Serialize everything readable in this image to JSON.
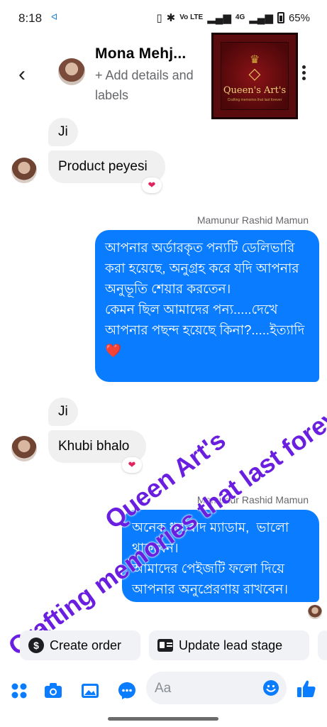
{
  "status": {
    "time": "8:18",
    "carrier": "ᐊ",
    "network": "Vo LTE",
    "net2": "4G",
    "battery": "65%"
  },
  "header": {
    "back_icon": "chevron-left-icon",
    "name": "Mona Mehj...",
    "subtitle": "+ Add details and labels",
    "logo": {
      "brand": "Queen's Art's",
      "tagline": "Crafting memories that last forever"
    },
    "more_icon": "more-vertical-icon"
  },
  "messages": {
    "in1_a": "Ji",
    "in1_b": "Product peyesi",
    "in1_react": "❤",
    "sender1": "Mamunur Rashid Mamun",
    "out1": "আপনার অর্ডারকৃত পন্যটি ডেলিভারি করা হয়েছে, অনুগ্রহ করে যদি আপনার অনুভূতি শেয়ার করতেন।\nকেমন ছিল আমাদের পন্য.....দেখে আপনার পছন্দ হয়েছে কিনা?.....ইত্যাদি❤️",
    "in2_a": "Ji",
    "in2_b": "Khubi bhalo",
    "in2_react": "❤",
    "sender2": "Mamunur Rashid Mamun",
    "out2": "অনেক ধন্যবাদ ম্যাডাম,  ভালো থাকবেন।\nআমাদের পেইজটি ফলো দিয়ে আপনার অনুপ্রেরণায় রাখবেন।"
  },
  "watermark": {
    "line1": "Queen Art's",
    "line2": "Crafting memories that last foreve"
  },
  "actions": {
    "create_order": "Create order",
    "update_lead": "Update lead stage"
  },
  "composer": {
    "placeholder": "Aa"
  },
  "colors": {
    "accent": "#0a7cff",
    "bubble_in": "#f0f0f0",
    "watermark": "#6a1fe0"
  }
}
